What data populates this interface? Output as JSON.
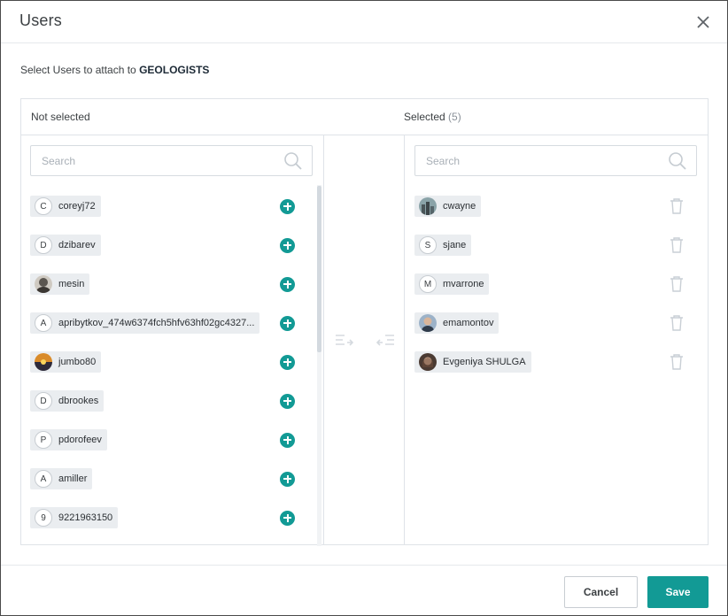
{
  "dialog": {
    "title": "Users",
    "subtitle_prefix": "Select Users to attach to",
    "group_name": "GEOLOGISTS"
  },
  "columns": {
    "not_selected_label": "Not selected",
    "selected_label": "Selected",
    "selected_count": "(5)"
  },
  "search": {
    "left_placeholder": "Search",
    "right_placeholder": "Search"
  },
  "not_selected_users": [
    {
      "initial": "C",
      "name": "coreyj72",
      "avatar": "initial"
    },
    {
      "initial": "D",
      "name": "dzibarev",
      "avatar": "initial"
    },
    {
      "initial": "",
      "name": "mesin",
      "avatar": "photo-portrait"
    },
    {
      "initial": "A",
      "name": "apribytkov_474w6374fch5hfv63hf02gc4327...",
      "avatar": "initial"
    },
    {
      "initial": "",
      "name": "jumbo80",
      "avatar": "photo-sunset"
    },
    {
      "initial": "D",
      "name": "dbrookes",
      "avatar": "initial"
    },
    {
      "initial": "P",
      "name": "pdorofeev",
      "avatar": "initial"
    },
    {
      "initial": "A",
      "name": "amiller",
      "avatar": "initial"
    },
    {
      "initial": "9",
      "name": "9221963150",
      "avatar": "initial"
    }
  ],
  "selected_users": [
    {
      "initial": "",
      "name": "cwayne",
      "avatar": "photo-city"
    },
    {
      "initial": "S",
      "name": "sjane",
      "avatar": "initial"
    },
    {
      "initial": "M",
      "name": "mvarrone",
      "avatar": "initial"
    },
    {
      "initial": "",
      "name": "emamontov",
      "avatar": "photo-man"
    },
    {
      "initial": "",
      "name": "Evgeniya SHULGA",
      "avatar": "photo-woman"
    }
  ],
  "footer": {
    "cancel_label": "Cancel",
    "save_label": "Save"
  },
  "colors": {
    "accent": "#129a95",
    "chip_bg": "#eaedf0",
    "border": "#dfe3e8"
  },
  "icons": {
    "close": "close-icon",
    "search": "search-icon",
    "add": "plus-circle-icon",
    "remove": "trash-icon",
    "move_right": "move-all-right-icon",
    "move_left": "move-all-left-icon"
  }
}
